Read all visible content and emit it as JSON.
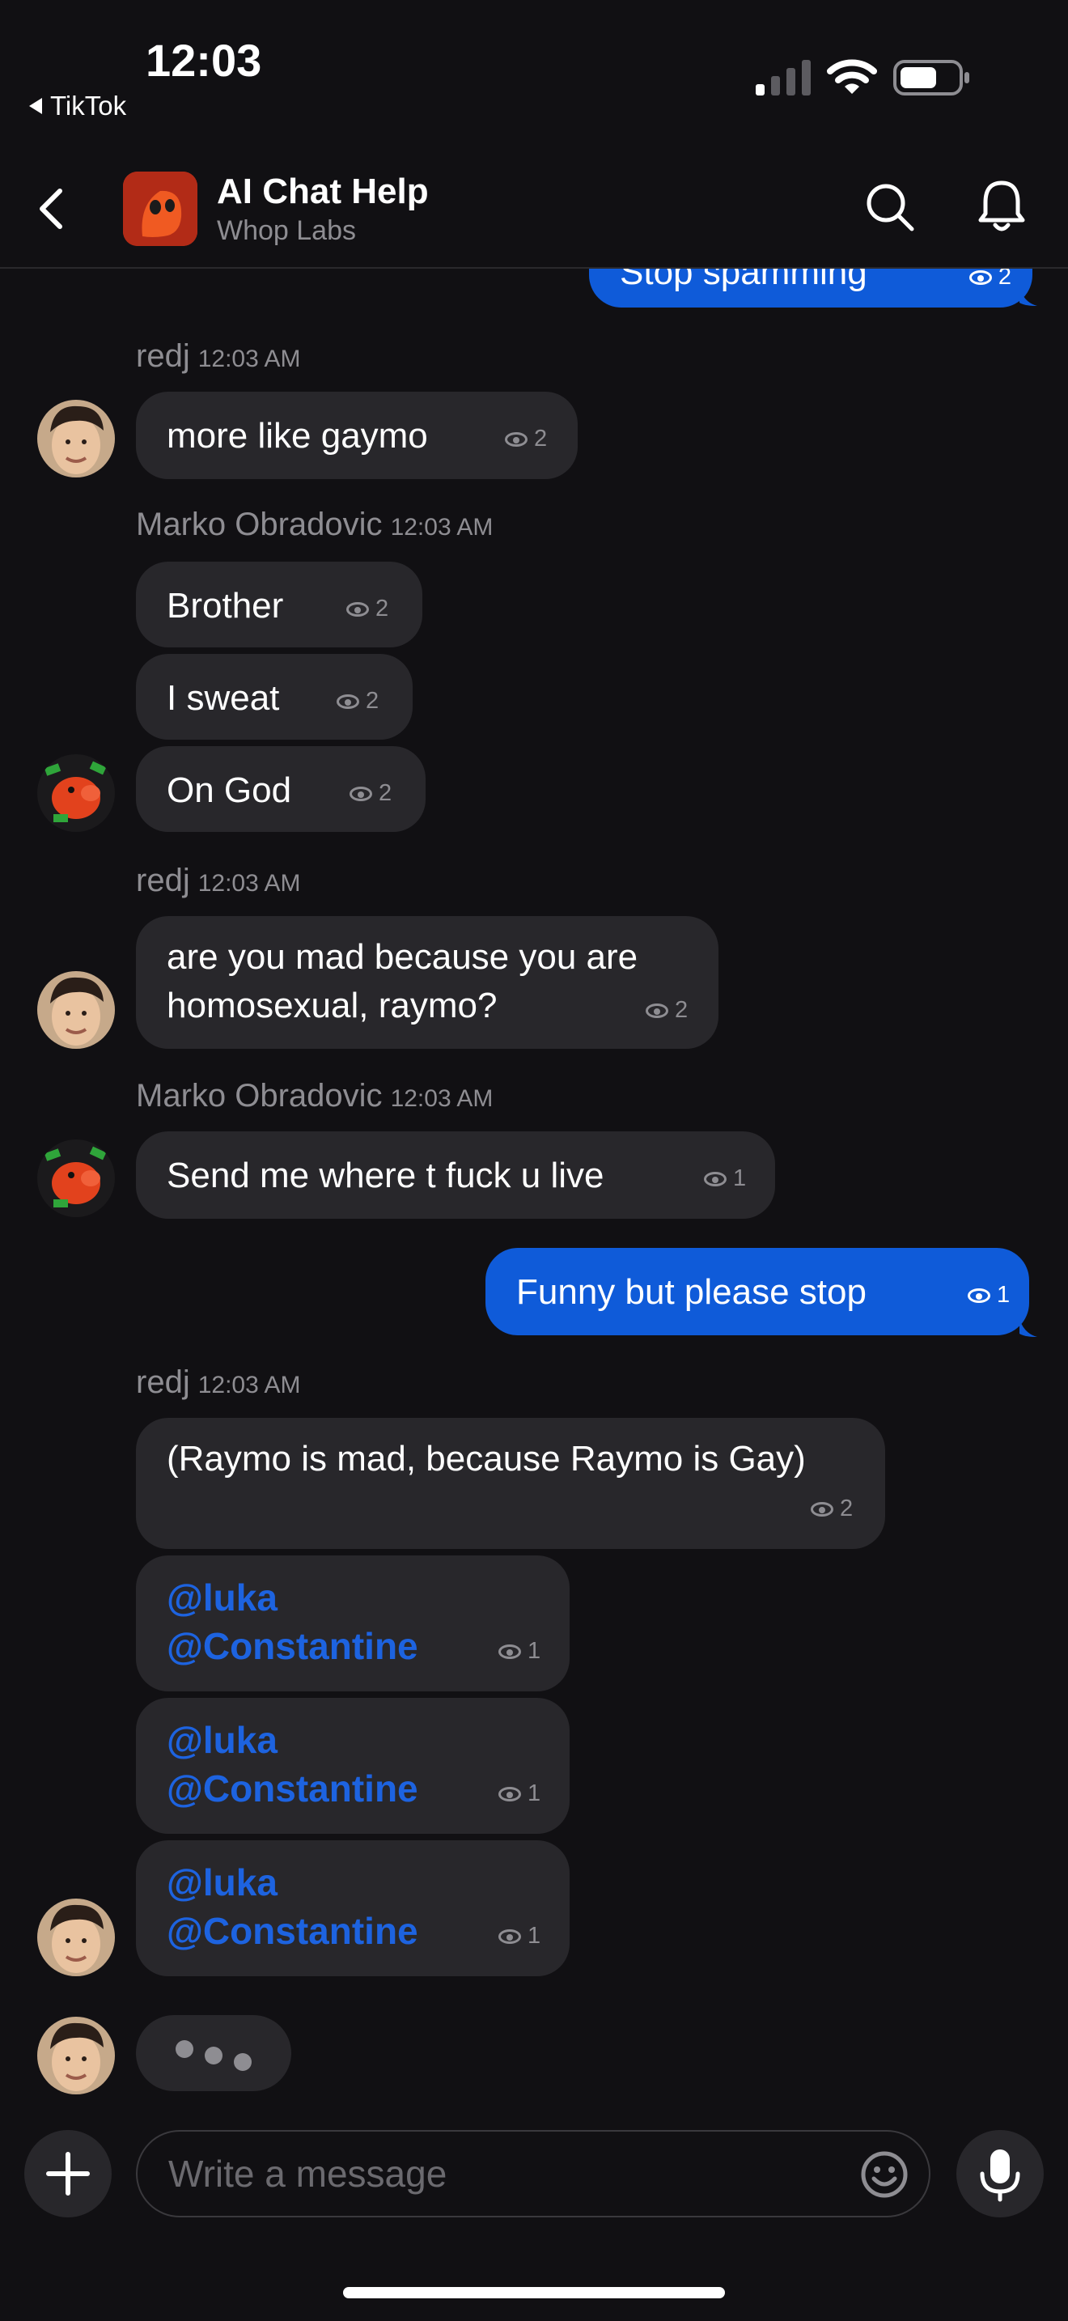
{
  "status_bar": {
    "time": "12:03",
    "back_app": "TikTok"
  },
  "header": {
    "title": "AI Chat Help",
    "subtitle": "Whop Labs"
  },
  "messages": {
    "m0": {
      "text": "Stop spamming",
      "seen": "2"
    },
    "g1": {
      "sender": "redj",
      "time": "12:03 AM"
    },
    "m1": {
      "text": "more like gaymo",
      "seen": "2"
    },
    "g2": {
      "sender": "Marko Obradovic",
      "time": "12:03 AM"
    },
    "m2": {
      "text": "Brother",
      "seen": "2"
    },
    "m3": {
      "text": "I sweat",
      "seen": "2"
    },
    "m4": {
      "text": "On God",
      "seen": "2"
    },
    "g3": {
      "sender": "redj",
      "time": "12:03 AM"
    },
    "m5": {
      "line1": "are you mad because you are",
      "line2": "homosexual, raymo?",
      "seen": "2"
    },
    "g4": {
      "sender": "Marko Obradovic",
      "time": "12:03 AM"
    },
    "m6": {
      "text": "Send me where t fuck u live",
      "seen": "1"
    },
    "m7": {
      "text": "Funny but please stop",
      "seen": "1"
    },
    "g5": {
      "sender": "redj",
      "time": "12:03 AM"
    },
    "m8": {
      "text": "(Raymo is mad, because Raymo is Gay)",
      "seen": "2"
    },
    "m9": {
      "line1": "@luka",
      "line2": "@Constantine",
      "seen": "1"
    },
    "m10": {
      "line1": "@luka",
      "line2": "@Constantine",
      "seen": "1"
    },
    "m11": {
      "line1": "@luka",
      "line2": "@Constantine",
      "seen": "1"
    }
  },
  "composer": {
    "placeholder": "Write a message"
  },
  "colors": {
    "background": "#111013",
    "bubble_incoming": "#28272b",
    "bubble_outgoing": "#0f5bd9",
    "mention": "#1d63e0",
    "muted": "#8e8d92"
  },
  "icons": [
    "back-chevron-icon",
    "search-icon",
    "bell-icon",
    "eye-icon",
    "plus-icon",
    "emoji-icon",
    "microphone-icon",
    "signal-icon",
    "wifi-icon",
    "battery-icon"
  ]
}
